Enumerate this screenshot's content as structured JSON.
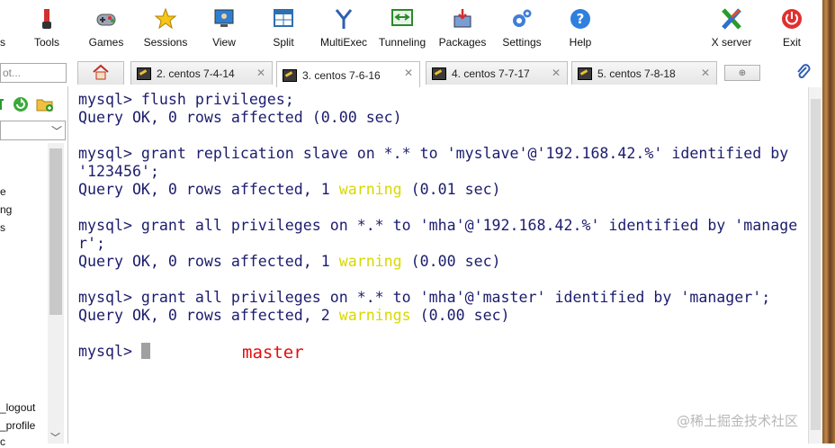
{
  "toolbar": {
    "items": [
      {
        "label": "rs",
        "icon": "servers-icon"
      },
      {
        "label": "Tools",
        "icon": "tools-icon"
      },
      {
        "label": "Games",
        "icon": "games-icon"
      },
      {
        "label": "Sessions",
        "icon": "sessions-star-icon"
      },
      {
        "label": "View",
        "icon": "view-monitor-icon"
      },
      {
        "label": "Split",
        "icon": "split-icon"
      },
      {
        "label": "MultiExec",
        "icon": "multiexec-icon"
      },
      {
        "label": "Tunneling",
        "icon": "tunneling-icon"
      },
      {
        "label": "Packages",
        "icon": "packages-icon"
      },
      {
        "label": "Settings",
        "icon": "settings-gear-icon"
      },
      {
        "label": "Help",
        "icon": "help-icon"
      },
      {
        "label": "X server",
        "icon": "x-server-icon"
      },
      {
        "label": "Exit",
        "icon": "exit-power-icon"
      }
    ]
  },
  "sidebar": {
    "search_text": "ot...",
    "items": [
      "e",
      "ng",
      "s",
      "_logout",
      "_profile",
      "c"
    ]
  },
  "tabs": [
    {
      "label": "2. centos 7-4-14",
      "active": false
    },
    {
      "label": "3. centos 7-6-16",
      "active": true
    },
    {
      "label": "4. centos 7-7-17",
      "active": false
    },
    {
      "label": "5. centos 7-8-18",
      "active": false
    }
  ],
  "terminal": {
    "lines": [
      "mysql> flush privileges;",
      "Query OK, 0 rows affected (0.00 sec)",
      "",
      "mysql> grant replication slave on *.* to 'myslave'@'192.168.42.%' identified by",
      "'123456';",
      "Query OK, 0 rows affected, 1 warning (0.01 sec)",
      "",
      "mysql> grant all privileges on *.* to 'mha'@'192.168.42.%' identified by 'manage",
      "r';",
      "Query OK, 0 rows affected, 1 warning (0.00 sec)",
      "",
      "mysql> grant all privileges on *.* to 'mha'@'master' identified by 'manager';",
      "Query OK, 0 rows affected, 2 warnings (0.00 sec)",
      "",
      "mysql> "
    ],
    "note": "master",
    "warning_color": "#d8d800",
    "text_color": "#1c1c6e"
  },
  "watermark": "@稀土掘金技术社区"
}
